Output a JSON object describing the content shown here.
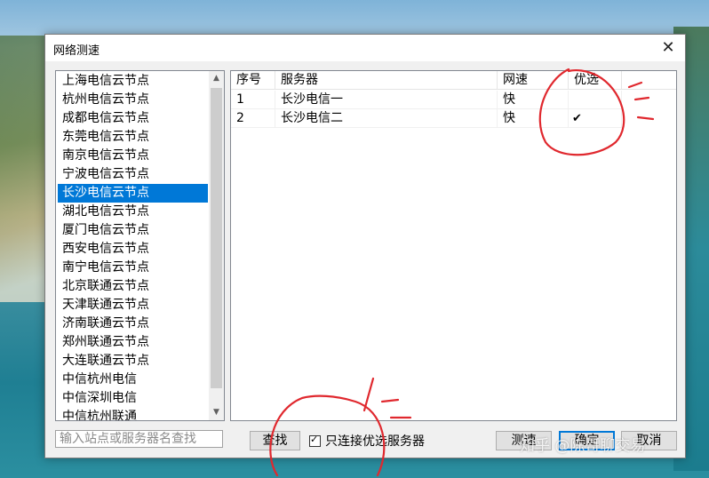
{
  "window": {
    "title": "网络测速",
    "close_glyph": "✕"
  },
  "sites": [
    "上海电信云节点",
    "杭州电信云节点",
    "成都电信云节点",
    "东莞电信云节点",
    "南京电信云节点",
    "宁波电信云节点",
    "长沙电信云节点",
    "湖北电信云节点",
    "厦门电信云节点",
    "西安电信云节点",
    "南宁电信云节点",
    "北京联通云节点",
    "天津联通云节点",
    "济南联通云节点",
    "郑州联通云节点",
    "大连联通云节点",
    "中信杭州电信",
    "中信深圳电信",
    "中信杭州联通"
  ],
  "selected_site": "长沙电信云节点",
  "table": {
    "headers": {
      "index": "序号",
      "server": "服务器",
      "speed": "网速",
      "preferred": "优选"
    },
    "rows": [
      {
        "index": "1",
        "server": "长沙电信一",
        "speed": "快",
        "preferred": ""
      },
      {
        "index": "2",
        "server": "长沙电信二",
        "speed": "快",
        "preferred": "✔"
      }
    ]
  },
  "search": {
    "placeholder": "输入站点或服务器名查找"
  },
  "buttons": {
    "find": "查找",
    "test": "测速",
    "ok": "确定",
    "cancel": "取消"
  },
  "only_preferred": {
    "label": "只连接优选服务器",
    "checked": true
  },
  "watermark": "知乎 @陈哥聊交易",
  "colors": {
    "selection": "#0078d7",
    "annotation": "#e0282e"
  }
}
